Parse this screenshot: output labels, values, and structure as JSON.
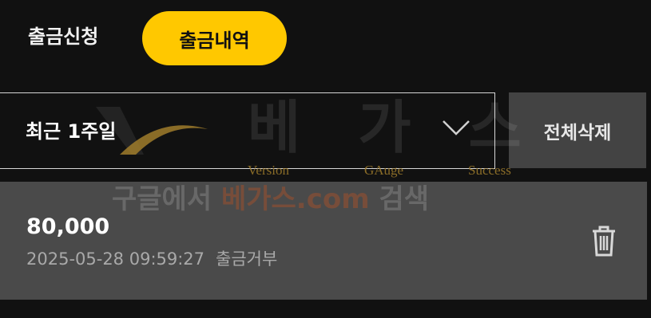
{
  "tabs": {
    "request_label": "출금신청",
    "history_label": "출금내역"
  },
  "filter": {
    "period_value": "최근 1주일",
    "delete_all_label": "전체삭제"
  },
  "history": [
    {
      "amount": "80,000",
      "datetime": "2025-05-28 09:59:27",
      "status": "출금거부"
    }
  ],
  "watermark": {
    "title": "베가스",
    "tags": [
      "Version",
      "GAuge",
      "Success"
    ],
    "search_prefix": "구글에서 ",
    "search_brand": "베가스.com",
    "search_suffix": " 검색"
  },
  "colors": {
    "accent": "#ffc800",
    "background": "#111111",
    "card": "#4a4a4a",
    "delete_button": "#434343"
  },
  "icons": {
    "dropdown": "chevron-down-icon",
    "delete": "trash-icon"
  }
}
